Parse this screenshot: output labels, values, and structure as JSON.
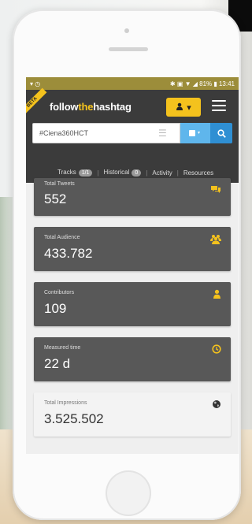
{
  "status_bar": {
    "left": "▾ ◷",
    "right": "✱ ▣ ▼ ◢ 81% ▮ 13:41"
  },
  "app": {
    "ribbon": "BETA",
    "logo_part1": "follow",
    "logo_part2": "the",
    "logo_part3": "hashtag",
    "user_icon": "user-icon",
    "user_caret": "▾"
  },
  "search": {
    "value": "#Ciena360HCT",
    "clear_glyph": "☰",
    "split_icon": "settings-toggle-icon",
    "go_icon": "search-icon"
  },
  "tabs": [
    {
      "label": "Tracks",
      "badge": "1/1"
    },
    {
      "label": "Historical",
      "badge": "0"
    },
    {
      "label": "Activity",
      "badge": ""
    },
    {
      "label": "Resources",
      "badge": ""
    }
  ],
  "stats": [
    {
      "label": "Total Tweets",
      "value": "552",
      "icon": "comments-icon"
    },
    {
      "label": "Total Audience",
      "value": "433.782",
      "icon": "users-icon"
    },
    {
      "label": "Contributors",
      "value": "109",
      "icon": "user-icon"
    },
    {
      "label": "Measured time",
      "value": "22 d",
      "icon": "clock-icon"
    },
    {
      "label": "Total Impressions",
      "value": "3.525.502",
      "icon": "globe-icon"
    }
  ],
  "colors": {
    "accent": "#f4c21d",
    "appbar": "#3b3b3b",
    "statusbar": "#9c8d3a",
    "search_blue": "#2f8fd3"
  }
}
